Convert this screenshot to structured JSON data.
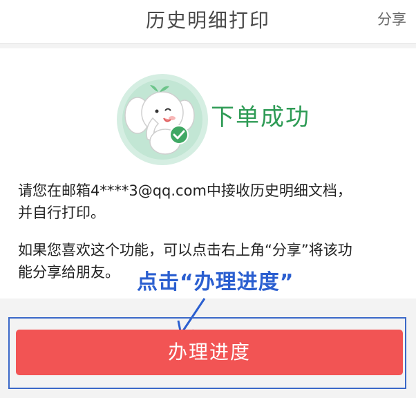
{
  "header": {
    "title": "历史明细打印",
    "share_label": "分享"
  },
  "success": {
    "title": "下单成功",
    "icon": "mascot-success-icon",
    "color": "#2e9b55"
  },
  "message": {
    "line1a": "请您在邮箱4****3@qq.com中接收历史明细文档，",
    "line1b": "并自行打印。",
    "line2a": "如果您喜欢这个功能，可以点击右上角“分享”将该功",
    "line2b": "能分享给朋友。"
  },
  "annotation": {
    "text": "点击“办理进度”",
    "color": "#2b5fd0"
  },
  "action": {
    "progress_label": "办理进度",
    "color": "#f25454"
  }
}
